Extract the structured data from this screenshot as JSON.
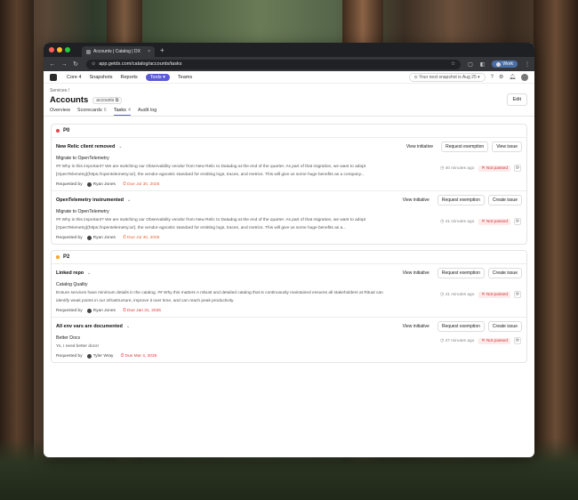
{
  "browser": {
    "tab_title": "Accounts | Catalog | DX",
    "tab_close": "×",
    "new_tab": "+",
    "url": "app.getdx.com/catalog/accounts/tasks",
    "profile_label": "Work",
    "traffic_colors": [
      "#ff5f57",
      "#febc2e",
      "#28c840"
    ]
  },
  "appnav": {
    "items": [
      "Core 4",
      "Snapshots",
      "Reports",
      "Tools",
      "Teams"
    ],
    "active": "Tools",
    "snapshot_notice": "Your next snapshot is Aug 25"
  },
  "header": {
    "breadcrumb": "Services /",
    "title": "Accounts",
    "id_badge": "accounts",
    "edit_label": "Edit"
  },
  "subtabs": [
    {
      "label": "Overview",
      "count": ""
    },
    {
      "label": "Scorecards",
      "count": "6"
    },
    {
      "label": "Tasks",
      "count": "4"
    },
    {
      "label": "Audit log",
      "count": ""
    }
  ],
  "groups": [
    {
      "label": "P0",
      "dot_color": "#e5484d",
      "tasks": [
        {
          "name": "New Relic client removed",
          "actions": [
            "View initiative",
            "Request exemption",
            "View issue"
          ],
          "sub_title": "Migrate to OpenTelemetry",
          "desc": "## Why is this important? We are switching our Observability vendor from New Relic to Datadog at the end of the quarter. As part of that migration, we want to adopt [OpenTelemetry](https://opentelemetry.io/), the vendor-agnostic standard for emitting logs, traces, and metrics. This will give us some huge benefits as a company...",
          "requested_by_label": "Requested by",
          "requester": "Ryan Jones",
          "due": "Due Jul 30, 2025",
          "due_style": "orange",
          "ago": "40 minutes ago",
          "status": "Not passed"
        },
        {
          "name": "OpenTelemetry instrumented",
          "actions": [
            "View initiative",
            "Request exemption",
            "Create issue"
          ],
          "sub_title": "Migrate to OpenTelemetry",
          "desc": "## Why is this important? We are switching our Observability vendor from New Relic to Datadog at the end of the quarter. As part of that migration, we want to adopt [OpenTelemetry](https://opentelemetry.io/), the vendor-agnostic standard for emitting logs, traces, and metrics. This will give us some huge benefits as a...",
          "requested_by_label": "Requested by",
          "requester": "Ryan Jones",
          "due": "Due Jul 30, 2025",
          "due_style": "orange",
          "ago": "41 minutes ago",
          "status": "Not passed"
        }
      ]
    },
    {
      "label": "P2",
      "dot_color": "#f5a524",
      "tasks": [
        {
          "name": "Linked repo",
          "actions": [
            "View initiative",
            "Request exemption",
            "Create issue"
          ],
          "sub_title": "Catalog Quality",
          "desc": "Ensure services have minimum details in the catalog. ## Why this matters A robust and detailed catalog that is continuously maintained ensures all stakeholders at Ritual can identify weak points in our infrastructure, improve it over time, and can reach peak productivity.",
          "requested_by_label": "Requested by",
          "requester": "Ryan Jones",
          "due": "Due Jan 31, 2025",
          "due_style": "red",
          "ago": "41 minutes ago",
          "status": "Not passed"
        },
        {
          "name": "All env vars are documented",
          "actions": [
            "View initiative",
            "Request exemption",
            "Create issue"
          ],
          "sub_title": "Better Docs",
          "desc": "Yo, I need better docs!",
          "requested_by_label": "Requested by",
          "requester": "Tyler Wray",
          "due": "Due Mar 4, 2025",
          "due_style": "red",
          "ago": "37 minutes ago",
          "status": "Not passed"
        }
      ]
    }
  ]
}
